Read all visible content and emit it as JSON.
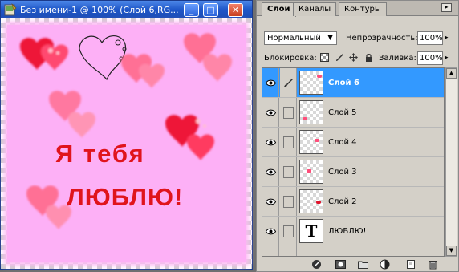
{
  "document": {
    "title": "Без имени-1 @ 100% (Слой 6,RG...",
    "canvas_text_line1": "Я тебя",
    "canvas_text_line2": "ЛЮБЛЮ!",
    "canvas_background": "#fdb0f6",
    "text_color": "#e0141c"
  },
  "window_buttons": {
    "minimize": "_",
    "maximize": "□",
    "close": "✕"
  },
  "panel": {
    "tabs": [
      {
        "label": "Слои",
        "active": true
      },
      {
        "label": "Каналы",
        "active": false
      },
      {
        "label": "Контуры",
        "active": false
      }
    ],
    "menu_glyph": "▸",
    "blend_mode": "Нормальный",
    "opacity_label": "Непрозрачность:",
    "opacity_value": "100%",
    "lock_label": "Блокировка:",
    "fill_label": "Заливка:",
    "fill_value": "100%",
    "lock_icons": [
      "lock-transparent-icon",
      "lock-brush-icon",
      "lock-move-icon",
      "lock-all-icon"
    ],
    "layers": [
      {
        "name": "Слой 6",
        "selected": true,
        "type": "pixel"
      },
      {
        "name": "Слой 5",
        "selected": false,
        "type": "pixel"
      },
      {
        "name": "Слой 4",
        "selected": false,
        "type": "pixel"
      },
      {
        "name": "Слой 3",
        "selected": false,
        "type": "pixel"
      },
      {
        "name": "Слой 2",
        "selected": false,
        "type": "pixel"
      },
      {
        "name": "ЛЮБЛЮ!",
        "selected": false,
        "type": "text",
        "thumb_glyph": "T"
      }
    ],
    "bottom_icons": [
      "layer-style-icon",
      "layer-mask-icon",
      "new-group-icon",
      "adjustment-layer-icon",
      "new-layer-icon",
      "delete-layer-icon"
    ],
    "selection_color": "#3399ff"
  }
}
